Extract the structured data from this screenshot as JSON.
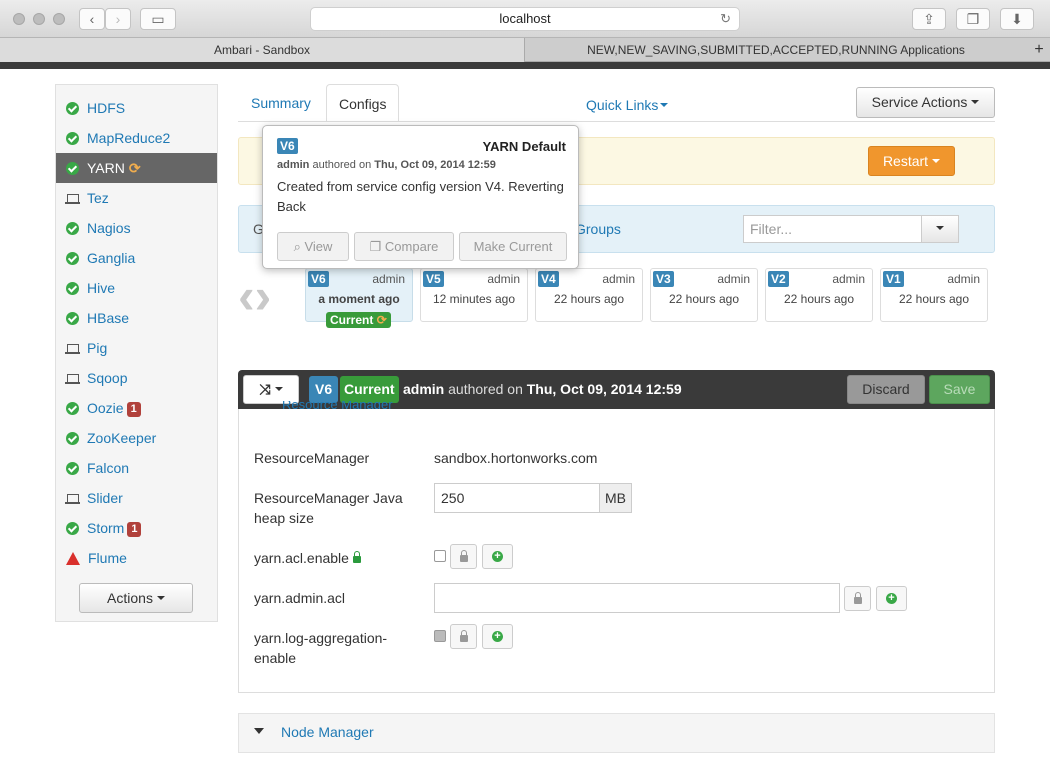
{
  "browser": {
    "url": "localhost",
    "tabs": [
      "Ambari - Sandbox",
      "NEW,NEW_SAVING,SUBMITTED,ACCEPTED,RUNNING Applications"
    ]
  },
  "sidebar": {
    "items": [
      {
        "label": "HDFS",
        "status": "ok"
      },
      {
        "label": "MapReduce2",
        "status": "ok"
      },
      {
        "label": "YARN",
        "status": "ok"
      },
      {
        "label": "Tez",
        "status": "client"
      },
      {
        "label": "Nagios",
        "status": "ok"
      },
      {
        "label": "Ganglia",
        "status": "ok"
      },
      {
        "label": "Hive",
        "status": "ok"
      },
      {
        "label": "HBase",
        "status": "ok"
      },
      {
        "label": "Pig",
        "status": "client"
      },
      {
        "label": "Sqoop",
        "status": "client"
      },
      {
        "label": "Oozie",
        "status": "ok",
        "badge": "1"
      },
      {
        "label": "ZooKeeper",
        "status": "ok"
      },
      {
        "label": "Falcon",
        "status": "ok"
      },
      {
        "label": "Slider",
        "status": "client"
      },
      {
        "label": "Storm",
        "status": "ok",
        "badge": "1"
      },
      {
        "label": "Flume",
        "status": "alert"
      }
    ],
    "actions_label": "Actions"
  },
  "nav": {
    "summary": "Summary",
    "configs": "Configs",
    "quick_links": "Quick Links",
    "service_actions": "Service Actions"
  },
  "restart_label": "Restart",
  "groups": {
    "label_left": "G",
    "label_right": "Groups",
    "filter_placeholder": "Filter..."
  },
  "versions": [
    {
      "v": "V6",
      "author": "admin",
      "time": "a moment ago",
      "current": true
    },
    {
      "v": "V5",
      "author": "admin",
      "time": "12 minutes ago"
    },
    {
      "v": "V4",
      "author": "admin",
      "time": "22 hours ago"
    },
    {
      "v": "V3",
      "author": "admin",
      "time": "22 hours ago"
    },
    {
      "v": "V2",
      "author": "admin",
      "time": "22 hours ago"
    },
    {
      "v": "V1",
      "author": "admin",
      "time": "22 hours ago"
    }
  ],
  "current_label": "Current",
  "popover": {
    "version": "V6",
    "title": "YARN Default",
    "author": "admin",
    "authored_on": "authored on",
    "date": "Thu, Oct 09, 2014 12:59",
    "description": "Created from service config version V4. Reverting Back",
    "view": "View",
    "compare": "Compare",
    "make_current": "Make Current"
  },
  "toolbar": {
    "version": "V6",
    "current": "Current",
    "author": "admin",
    "authored_on": "authored on",
    "date": "Thu, Oct 09, 2014 12:59",
    "discard": "Discard",
    "save": "Save"
  },
  "section_title_peek": "Resource Manager",
  "config": {
    "rm_label": "ResourceManager",
    "rm_value": "sandbox.hortonworks.com",
    "heap_label": "ResourceManager Java heap size",
    "heap_value": "250",
    "heap_unit": "MB",
    "acl_enable_label": "yarn.acl.enable",
    "admin_acl_label": "yarn.admin.acl",
    "admin_acl_value": "",
    "log_agg_label": "yarn.log-aggregation-enable"
  },
  "node_manager_title": "Node Manager"
}
